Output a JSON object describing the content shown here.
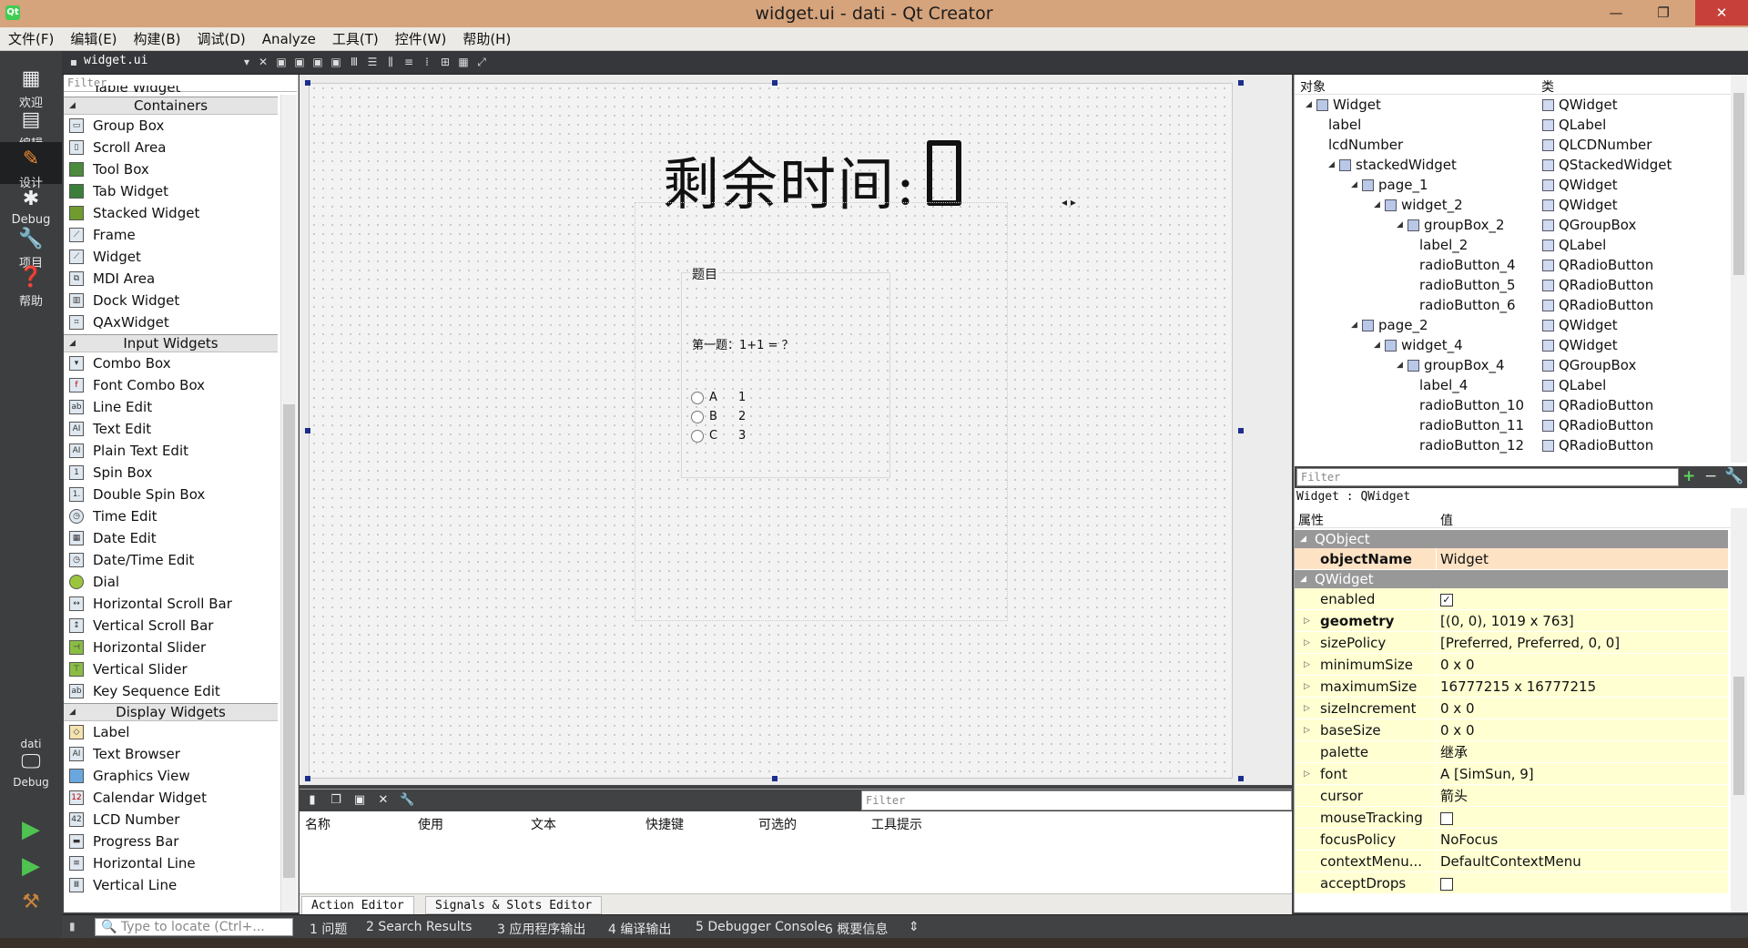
{
  "window": {
    "title": "widget.ui - dati - Qt Creator",
    "app_icon_text": "Qt"
  },
  "window_controls": {
    "minimize": "—",
    "maximize": "❐",
    "close": "✕"
  },
  "menu": [
    "文件(F)",
    "编辑(E)",
    "构建(B)",
    "调试(D)",
    "Analyze",
    "工具(T)",
    "控件(W)",
    "帮助(H)"
  ],
  "modes": [
    {
      "label": "欢迎",
      "icon": "grid-icon"
    },
    {
      "label": "编辑",
      "icon": "document-icon"
    },
    {
      "label": "设计",
      "icon": "pencil-icon"
    },
    {
      "label": "Debug",
      "icon": "bug-icon"
    },
    {
      "label": "项目",
      "icon": "wrench-icon"
    },
    {
      "label": "帮助",
      "icon": "help-icon"
    }
  ],
  "kit": {
    "project": "dati",
    "mode": "Debug"
  },
  "editor_tab": "widget.ui",
  "widget_box": {
    "filter_placeholder": "Filter",
    "partial_top": "Table Widget",
    "categories": [
      "Containers",
      "Input Widgets",
      "Display Widgets"
    ],
    "containers": [
      "Group Box",
      "Scroll Area",
      "Tool Box",
      "Tab Widget",
      "Stacked Widget",
      "Frame",
      "Widget",
      "MDI Area",
      "Dock Widget",
      "QAxWidget"
    ],
    "input": [
      "Combo Box",
      "Font Combo Box",
      "Line Edit",
      "Text Edit",
      "Plain Text Edit",
      "Spin Box",
      "Double Spin Box",
      "Time Edit",
      "Date Edit",
      "Date/Time Edit",
      "Dial",
      "Horizontal Scroll Bar",
      "Vertical Scroll Bar",
      "Horizontal Slider",
      "Vertical Slider",
      "Key Sequence Edit"
    ],
    "display": [
      "Label",
      "Text Browser",
      "Graphics View",
      "Calendar Widget",
      "LCD Number",
      "Progress Bar",
      "Horizontal Line",
      "Vertical Line"
    ]
  },
  "form": {
    "title": "剩余时间:",
    "groupbox_title": "题目",
    "question": "第一题：1+1 = ？",
    "options": [
      {
        "letter": "A",
        "value": "1"
      },
      {
        "letter": "B",
        "value": "2"
      },
      {
        "letter": "C",
        "value": "3"
      }
    ]
  },
  "action_editor": {
    "filter_placeholder": "Filter",
    "columns": [
      "名称",
      "使用",
      "文本",
      "快捷键",
      "可选的",
      "工具提示"
    ],
    "tabs": [
      "Action Editor",
      "Signals & Slots Editor"
    ]
  },
  "object_inspector": {
    "headers": [
      "对象",
      "类"
    ],
    "rows": [
      {
        "name": "Widget",
        "class": "QWidget",
        "depth": 0,
        "expand": "◢"
      },
      {
        "name": "label",
        "class": "QLabel",
        "depth": 1,
        "expand": ""
      },
      {
        "name": "lcdNumber",
        "class": "QLCDNumber",
        "depth": 1,
        "expand": ""
      },
      {
        "name": "stackedWidget",
        "class": "QStackedWidget",
        "depth": 1,
        "expand": "◢"
      },
      {
        "name": "page_1",
        "class": "QWidget",
        "depth": 2,
        "expand": "◢"
      },
      {
        "name": "widget_2",
        "class": "QWidget",
        "depth": 3,
        "expand": "◢"
      },
      {
        "name": "groupBox_2",
        "class": "QGroupBox",
        "depth": 4,
        "expand": "◢"
      },
      {
        "name": "label_2",
        "class": "QLabel",
        "depth": 5,
        "expand": ""
      },
      {
        "name": "radioButton_4",
        "class": "QRadioButton",
        "depth": 5,
        "expand": ""
      },
      {
        "name": "radioButton_5",
        "class": "QRadioButton",
        "depth": 5,
        "expand": ""
      },
      {
        "name": "radioButton_6",
        "class": "QRadioButton",
        "depth": 5,
        "expand": ""
      },
      {
        "name": "page_2",
        "class": "QWidget",
        "depth": 2,
        "expand": "◢"
      },
      {
        "name": "widget_4",
        "class": "QWidget",
        "depth": 3,
        "expand": "◢"
      },
      {
        "name": "groupBox_4",
        "class": "QGroupBox",
        "depth": 4,
        "expand": "◢"
      },
      {
        "name": "label_4",
        "class": "QLabel",
        "depth": 5,
        "expand": ""
      },
      {
        "name": "radioButton_10",
        "class": "QRadioButton",
        "depth": 5,
        "expand": ""
      },
      {
        "name": "radioButton_11",
        "class": "QRadioButton",
        "depth": 5,
        "expand": ""
      },
      {
        "name": "radioButton_12",
        "class": "QRadioButton",
        "depth": 5,
        "expand": ""
      }
    ]
  },
  "property_editor": {
    "filter_placeholder": "Filter",
    "class_line": "Widget : QWidget",
    "headers": [
      "属性",
      "值"
    ],
    "sections": [
      "QObject",
      "QWidget"
    ],
    "object_name": {
      "name": "objectName",
      "value": "Widget"
    },
    "rows": [
      {
        "name": "enabled",
        "value": "",
        "check": "✓",
        "bold": false,
        "expand": false
      },
      {
        "name": "geometry",
        "value": "[(0, 0), 1019 x 763]",
        "bold": true,
        "expand": true
      },
      {
        "name": "sizePolicy",
        "value": "[Preferred, Preferred, 0, 0]",
        "bold": false,
        "expand": true
      },
      {
        "name": "minimumSize",
        "value": "0 x 0",
        "bold": false,
        "expand": true
      },
      {
        "name": "maximumSize",
        "value": "16777215 x 16777215",
        "bold": false,
        "expand": true
      },
      {
        "name": "sizeIncrement",
        "value": "0 x 0",
        "bold": false,
        "expand": true
      },
      {
        "name": "baseSize",
        "value": "0 x 0",
        "bold": false,
        "expand": true
      },
      {
        "name": "palette",
        "value": "继承",
        "bold": false,
        "expand": false
      },
      {
        "name": "font",
        "value": "A  [SimSun, 9]",
        "bold": false,
        "expand": true
      },
      {
        "name": "cursor",
        "value": "箭头",
        "bold": false,
        "expand": false
      },
      {
        "name": "mouseTracking",
        "value": "",
        "check": "",
        "bold": false,
        "expand": false
      },
      {
        "name": "focusPolicy",
        "value": "NoFocus",
        "bold": false,
        "expand": false
      },
      {
        "name": "contextMenu...",
        "value": "DefaultContextMenu",
        "bold": false,
        "expand": false
      },
      {
        "name": "acceptDrops",
        "value": "",
        "check": "",
        "bold": false,
        "expand": false
      }
    ]
  },
  "status_bar": {
    "locator_placeholder": "Type to locate (Ctrl+...",
    "outputs": [
      "1 问题",
      "2 Search Results",
      "3 应用程序输出",
      "4 编译输出",
      "5 Debugger Console",
      "6 概要信息"
    ]
  },
  "colors": {
    "titlebar": "#d5a37c",
    "mode_bar": "#3c3e40",
    "property_yellow": "#ffffd2",
    "property_objectname": "#fde2c4",
    "property_section": "#989898",
    "selection_handle": "#1d2d8c"
  }
}
